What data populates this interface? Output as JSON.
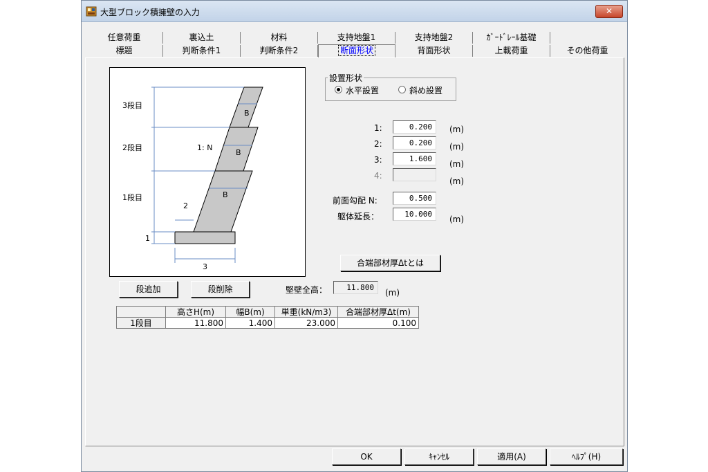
{
  "window": {
    "title": "大型ブロック積擁壁の入力",
    "close_label": "✕"
  },
  "tabs": {
    "row1": [
      "任意荷重",
      "裏込土",
      "材料",
      "支持地盤1",
      "支持地盤2",
      "ｶﾞｰﾄﾞﾚｰﾙ基礎"
    ],
    "row2": [
      "標題",
      "判断条件1",
      "判断条件2",
      "断面形状",
      "背面形状",
      "上載荷重",
      "その他荷重"
    ],
    "active": "断面形状"
  },
  "diagram": {
    "tier3": "3段目",
    "tier2": "2段目",
    "tier1": "1段目",
    "slope": "1: N",
    "width": "B",
    "dim1": "1",
    "dim2": "2",
    "dim3": "3"
  },
  "placement": {
    "legend": "設置形状",
    "horizontal": "水平設置",
    "inclined": "斜め設置",
    "selected": "horizontal"
  },
  "dims": [
    {
      "label": "1:",
      "value": "0.200",
      "unit": "(m)",
      "enabled": true
    },
    {
      "label": "2:",
      "value": "0.200",
      "unit": "(m)",
      "enabled": true
    },
    {
      "label": "3:",
      "value": "1.600",
      "unit": "(m)",
      "enabled": true
    },
    {
      "label": "4:",
      "value": "",
      "unit": "(m)",
      "enabled": false
    }
  ],
  "slope_field": {
    "label": "前面勾配 N:",
    "value": "0.500"
  },
  "length_field": {
    "label": "躯体延長：",
    "value": "10.000",
    "unit": "(m)"
  },
  "joint_button": "合端部材厚Δtとは",
  "add_button": "段追加",
  "delete_button": "段削除",
  "total_height": {
    "label": "堅壁全高：",
    "value": "11.800",
    "unit": "(m)"
  },
  "table": {
    "headers": [
      "",
      "高さH(m)",
      "幅B(m)",
      "単重(kN/m3)",
      "合端部材厚Δt(m)"
    ],
    "rows": [
      [
        "1段目",
        "11.800",
        "1.400",
        "23.000",
        "0.100"
      ]
    ]
  },
  "footer": {
    "ok": "OK",
    "cancel": "ｷｬﾝｾﾙ",
    "apply": "適用(A)",
    "help": "ﾍﾙﾌﾟ(H)"
  }
}
